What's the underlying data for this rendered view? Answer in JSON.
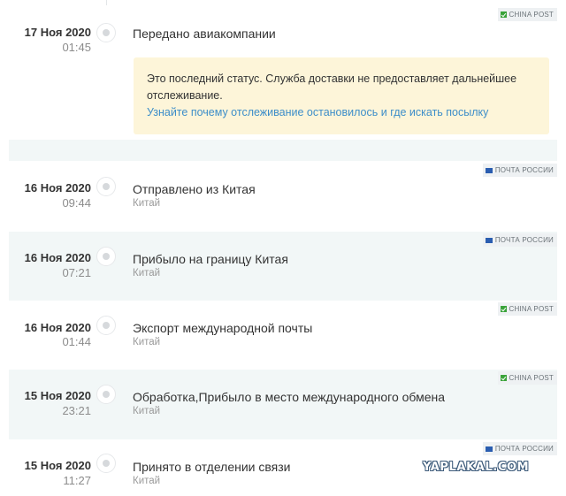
{
  "events": [
    {
      "date": "17 Ноя 2020",
      "time": "01:45",
      "status": "Передано авиакомпании",
      "location": "",
      "source": "CHINA POST",
      "source_type": "china",
      "notice": {
        "text": "Это последний статус. Служба доставки не предоставляет дальнейшее отслеживание.",
        "link": "Узнайте почему отслеживание остановилось и где искать посылку"
      }
    },
    {
      "date": "16 Ноя 2020",
      "time": "09:44",
      "status": "Отправлено из Китая",
      "location": "Китай",
      "source": "ПОЧТА РОССИИ",
      "source_type": "russia"
    },
    {
      "date": "16 Ноя 2020",
      "time": "07:21",
      "status": "Прибыло на границу Китая",
      "location": "Китай",
      "source": "ПОЧТА РОССИИ",
      "source_type": "russia"
    },
    {
      "date": "16 Ноя 2020",
      "time": "01:44",
      "status": "Экспорт международной почты",
      "location": "Китай",
      "source": "CHINA POST",
      "source_type": "china"
    },
    {
      "date": "15 Ноя 2020",
      "time": "23:21",
      "status": "Обработка,Прибыло в место международного обмена",
      "location": "Китай",
      "source": "CHINA POST",
      "source_type": "china"
    },
    {
      "date": "15 Ноя 2020",
      "time": "11:27",
      "status": "Принято в отделении связи",
      "location": "Китай",
      "source": "ПОЧТА РОССИИ",
      "source_type": "russia"
    }
  ],
  "watermark": "YAPLAKAL.COM",
  "colors": {
    "link": "#3d8ec9",
    "notice_bg": "#fdf5d9",
    "row_tint": "#f2f7f7"
  }
}
